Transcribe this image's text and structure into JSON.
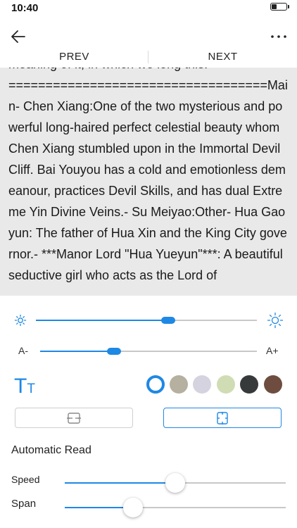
{
  "status_bar": {
    "time": "10:40",
    "battery_level": 0.3
  },
  "header": {
    "back_icon": "arrow-left-icon",
    "more_icon": "more-horizontal-icon",
    "prev_label": "PREV",
    "next_label": "NEXT"
  },
  "reader": {
    "text": "meaning of it, in which we long this.=============================================Main- Chen Xiang:One of the two mysterious and powerful long-haired perfect celestial beauty whom Chen Xiang stumbled upon in the Immortal Devil Cliff. Bai Youyou has a cold and emotionless demeanour, practices Devil Skills, and has dual Extreme Yin Divine Veins.- Su Meiyao:Other- Hua Gaoyun: The father of Hua Xin and the King City governor.- ***Manor Lord \"Hua Yueyun\"***: A beautiful seductive girl who acts as the Lord of"
  },
  "settings": {
    "brightness": {
      "low_icon": "sun-small-icon",
      "high_icon": "sun-large-icon",
      "value": 0.6
    },
    "font_size": {
      "decrease_label": "A-",
      "increase_label": "A+",
      "value": 0.34
    },
    "typeface_icon": "font-size-icon",
    "typeface_big": "T",
    "typeface_small": "T",
    "theme_colors": [
      {
        "color": "#ffffff",
        "selected": true
      },
      {
        "color": "#b5b09f",
        "selected": false
      },
      {
        "color": "#d6d3e0",
        "selected": false
      },
      {
        "color": "#d0ddb4",
        "selected": false
      },
      {
        "color": "#363a3b",
        "selected": false
      },
      {
        "color": "#6e4d40",
        "selected": false
      }
    ],
    "layout_modes": [
      {
        "icon": "page-flip-horizontal-icon",
        "selected": false
      },
      {
        "icon": "page-scroll-vertical-icon",
        "selected": true
      }
    ],
    "auto_read": {
      "title": "Automatic Read",
      "speed_label": "Speed",
      "speed_value": 0.5,
      "span_label": "Span",
      "span_value": 0.31
    }
  },
  "colors": {
    "accent": "#1e88e5",
    "reader_bg": "#e9e9e9",
    "track": "#c8c8c8"
  }
}
